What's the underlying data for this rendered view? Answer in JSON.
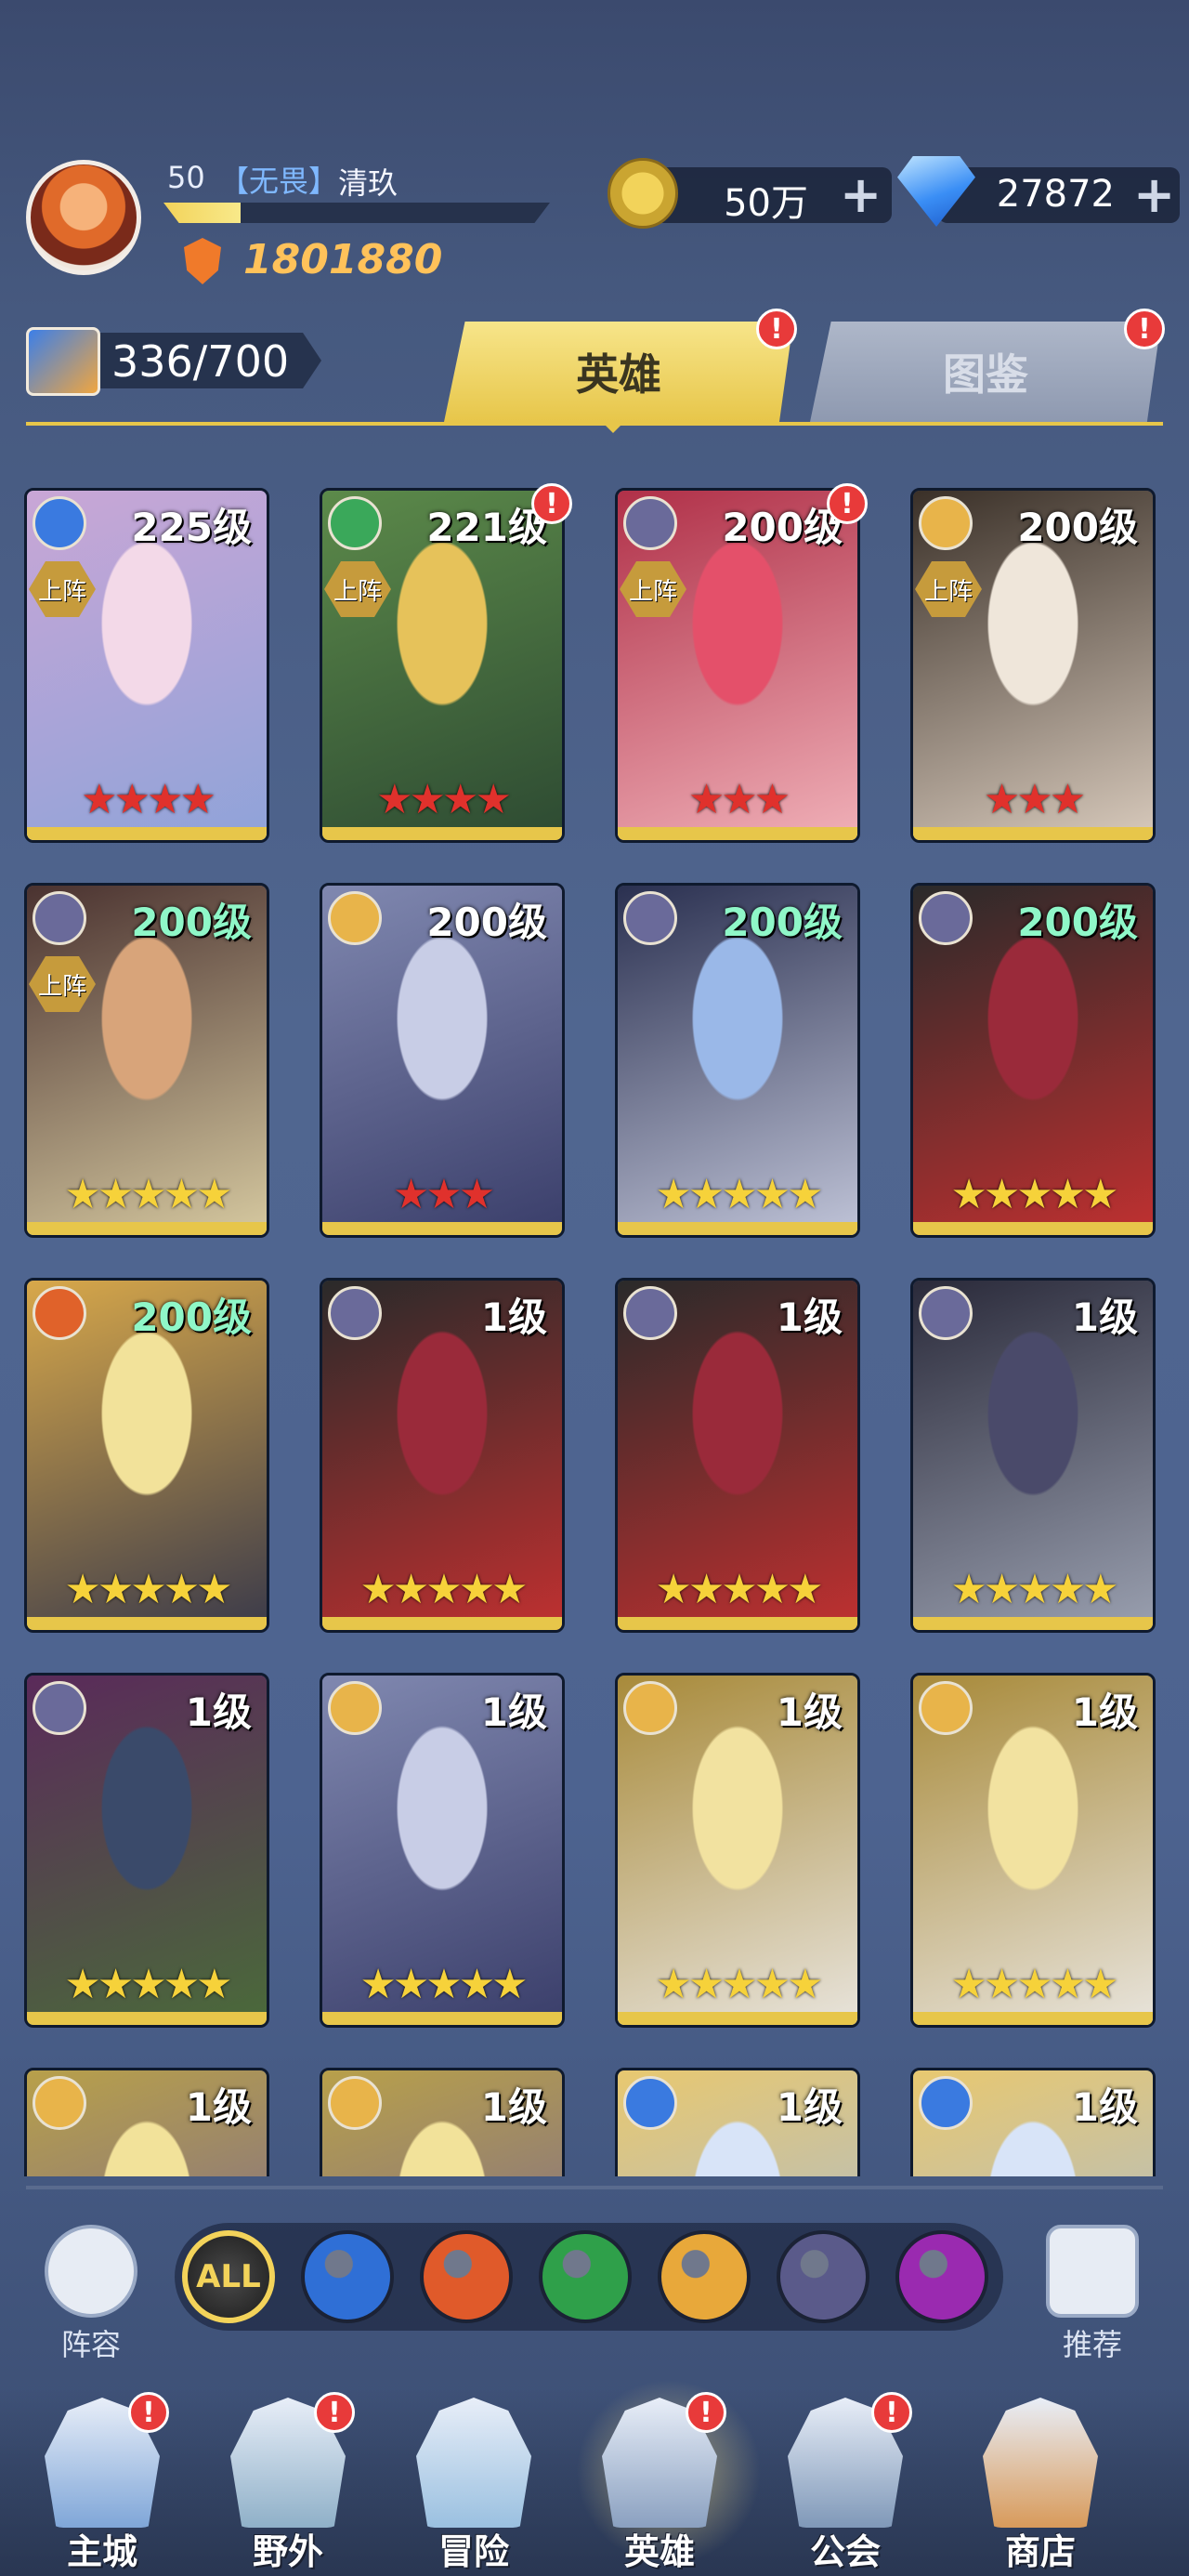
{
  "player": {
    "level": "50",
    "guild": "【无畏】",
    "name": "清玖",
    "exp_fraction": 0.2,
    "power": "1801880"
  },
  "resources": {
    "gold": "50万",
    "gems": "27872",
    "plus": "+"
  },
  "hero_count": "336/700",
  "tabs": [
    {
      "label": "英雄",
      "active": true
    },
    {
      "label": "图鉴",
      "active": false
    }
  ],
  "badge_symbol": "!",
  "lineup_tag": "上阵",
  "heroes": [
    {
      "level": "225级",
      "faction": "water",
      "in_lineup": true,
      "stars": 4,
      "star_color": "red",
      "badge": false,
      "colors": [
        "#f3d9e8",
        "#c9a6d6",
        "#8fa3d9"
      ]
    },
    {
      "level": "221级",
      "faction": "nature",
      "in_lineup": true,
      "stars": 4,
      "star_color": "red",
      "badge": true,
      "colors": [
        "#e6c25a",
        "#5c8a4a",
        "#2d4a32"
      ]
    },
    {
      "level": "200级",
      "faction": "dark",
      "in_lineup": true,
      "stars": 3,
      "star_color": "red",
      "badge": true,
      "colors": [
        "#e4506a",
        "#b03048",
        "#f0b0b8"
      ]
    },
    {
      "level": "200级",
      "faction": "light",
      "in_lineup": true,
      "stars": 3,
      "star_color": "red",
      "badge": false,
      "colors": [
        "#efe6da",
        "#3a3028",
        "#d8cabc"
      ]
    },
    {
      "level": "200级",
      "faction": "dark",
      "in_lineup": true,
      "stars": 5,
      "star_color": "gold",
      "badge": false,
      "level_green": true,
      "colors": [
        "#d8a47a",
        "#4a3230",
        "#d6c9a0"
      ]
    },
    {
      "level": "200级",
      "faction": "light",
      "in_lineup": false,
      "stars": 3,
      "star_color": "red",
      "badge": false,
      "colors": [
        "#c8cde6",
        "#8088b0",
        "#3a3e6a"
      ]
    },
    {
      "level": "200级",
      "faction": "dark",
      "in_lineup": false,
      "stars": 5,
      "star_color": "gold",
      "badge": false,
      "level_green": true,
      "colors": [
        "#9ab8e8",
        "#2a3050",
        "#c0c4d8"
      ]
    },
    {
      "level": "200级",
      "faction": "dark",
      "in_lineup": false,
      "stars": 5,
      "star_color": "gold",
      "badge": false,
      "level_green": true,
      "colors": [
        "#9a2a3a",
        "#2a2a2a",
        "#c03030"
      ]
    },
    {
      "level": "200级",
      "faction": "fire",
      "in_lineup": false,
      "stars": 5,
      "star_color": "gold",
      "badge": false,
      "level_green": true,
      "colors": [
        "#f2e29a",
        "#d8a84a",
        "#3a3a4a"
      ]
    },
    {
      "level": "1级",
      "faction": "dark",
      "in_lineup": false,
      "stars": 5,
      "star_color": "gold",
      "badge": false,
      "colors": [
        "#9a2a3a",
        "#2a2a2a",
        "#c03030"
      ]
    },
    {
      "level": "1级",
      "faction": "dark",
      "in_lineup": false,
      "stars": 5,
      "star_color": "gold",
      "badge": false,
      "colors": [
        "#9a2a3a",
        "#2a2a2a",
        "#c03030"
      ]
    },
    {
      "level": "1级",
      "faction": "dark",
      "in_lineup": false,
      "stars": 5,
      "star_color": "gold",
      "badge": false,
      "colors": [
        "#4a4a6a",
        "#2a2a3a",
        "#9aa0b0"
      ]
    },
    {
      "level": "1级",
      "faction": "dark",
      "in_lineup": false,
      "stars": 5,
      "star_color": "gold",
      "badge": false,
      "colors": [
        "#3a4a6a",
        "#5a2a5a",
        "#4a6a3a"
      ]
    },
    {
      "level": "1级",
      "faction": "light",
      "in_lineup": false,
      "stars": 5,
      "star_color": "gold",
      "badge": false,
      "colors": [
        "#c8cde6",
        "#8088b0",
        "#3a3e6a"
      ]
    },
    {
      "level": "1级",
      "faction": "light",
      "in_lineup": false,
      "stars": 5,
      "star_color": "gold",
      "badge": false,
      "colors": [
        "#f2e2a0",
        "#a88a3a",
        "#e8e4dc"
      ]
    },
    {
      "level": "1级",
      "faction": "light",
      "in_lineup": false,
      "stars": 5,
      "star_color": "gold",
      "badge": false,
      "colors": [
        "#f2e2a0",
        "#a88a3a",
        "#e8e4dc"
      ]
    },
    {
      "level": "1级",
      "faction": "light",
      "in_lineup": false,
      "stars": 0,
      "star_color": "gold",
      "badge": false,
      "colors": [
        "#f2e29a",
        "#b8a04a",
        "#6a5aa0"
      ]
    },
    {
      "level": "1级",
      "faction": "light",
      "in_lineup": false,
      "stars": 0,
      "star_color": "gold",
      "badge": false,
      "colors": [
        "#f2e29a",
        "#b8a04a",
        "#6a5aa0"
      ]
    },
    {
      "level": "1级",
      "faction": "water",
      "in_lineup": false,
      "stars": 0,
      "star_color": "gold",
      "badge": false,
      "colors": [
        "#d8e4f8",
        "#e8c870",
        "#9ab8e8"
      ]
    },
    {
      "level": "1级",
      "faction": "water",
      "in_lineup": false,
      "stars": 0,
      "star_color": "gold",
      "badge": false,
      "colors": [
        "#d8e4f8",
        "#e8c870",
        "#9ab8e8"
      ]
    }
  ],
  "faction_colors": {
    "water": "#3a7ae0",
    "nature": "#3aa85a",
    "dark": "#6a6a9a",
    "light": "#e8b44a",
    "fire": "#e0622a",
    "void": "#a03ab8"
  },
  "filters": {
    "lineup_label": "阵容",
    "recommend_label": "推荐",
    "all_label": "ALL",
    "factions": [
      {
        "name": "water",
        "color": "#2f6fd6"
      },
      {
        "name": "fire",
        "color": "#e05a2a"
      },
      {
        "name": "nature",
        "color": "#2fa04a"
      },
      {
        "name": "light",
        "color": "#e8a83a"
      },
      {
        "name": "dark",
        "color": "#5a5a8a"
      },
      {
        "name": "void",
        "color": "#9a2ab0"
      }
    ]
  },
  "nav": [
    {
      "label": "主城",
      "badge": true,
      "color": "#7fa6d8"
    },
    {
      "label": "野外",
      "badge": true,
      "color": "#8fb0c8"
    },
    {
      "label": "冒险",
      "badge": false,
      "color": "#9ac0e0"
    },
    {
      "label": "英雄",
      "badge": true,
      "color": "#8aa0c0",
      "active": true
    },
    {
      "label": "公会",
      "badge": true,
      "color": "#7f98b8"
    },
    {
      "label": "商店",
      "badge": false,
      "color": "#d89a5a"
    }
  ]
}
